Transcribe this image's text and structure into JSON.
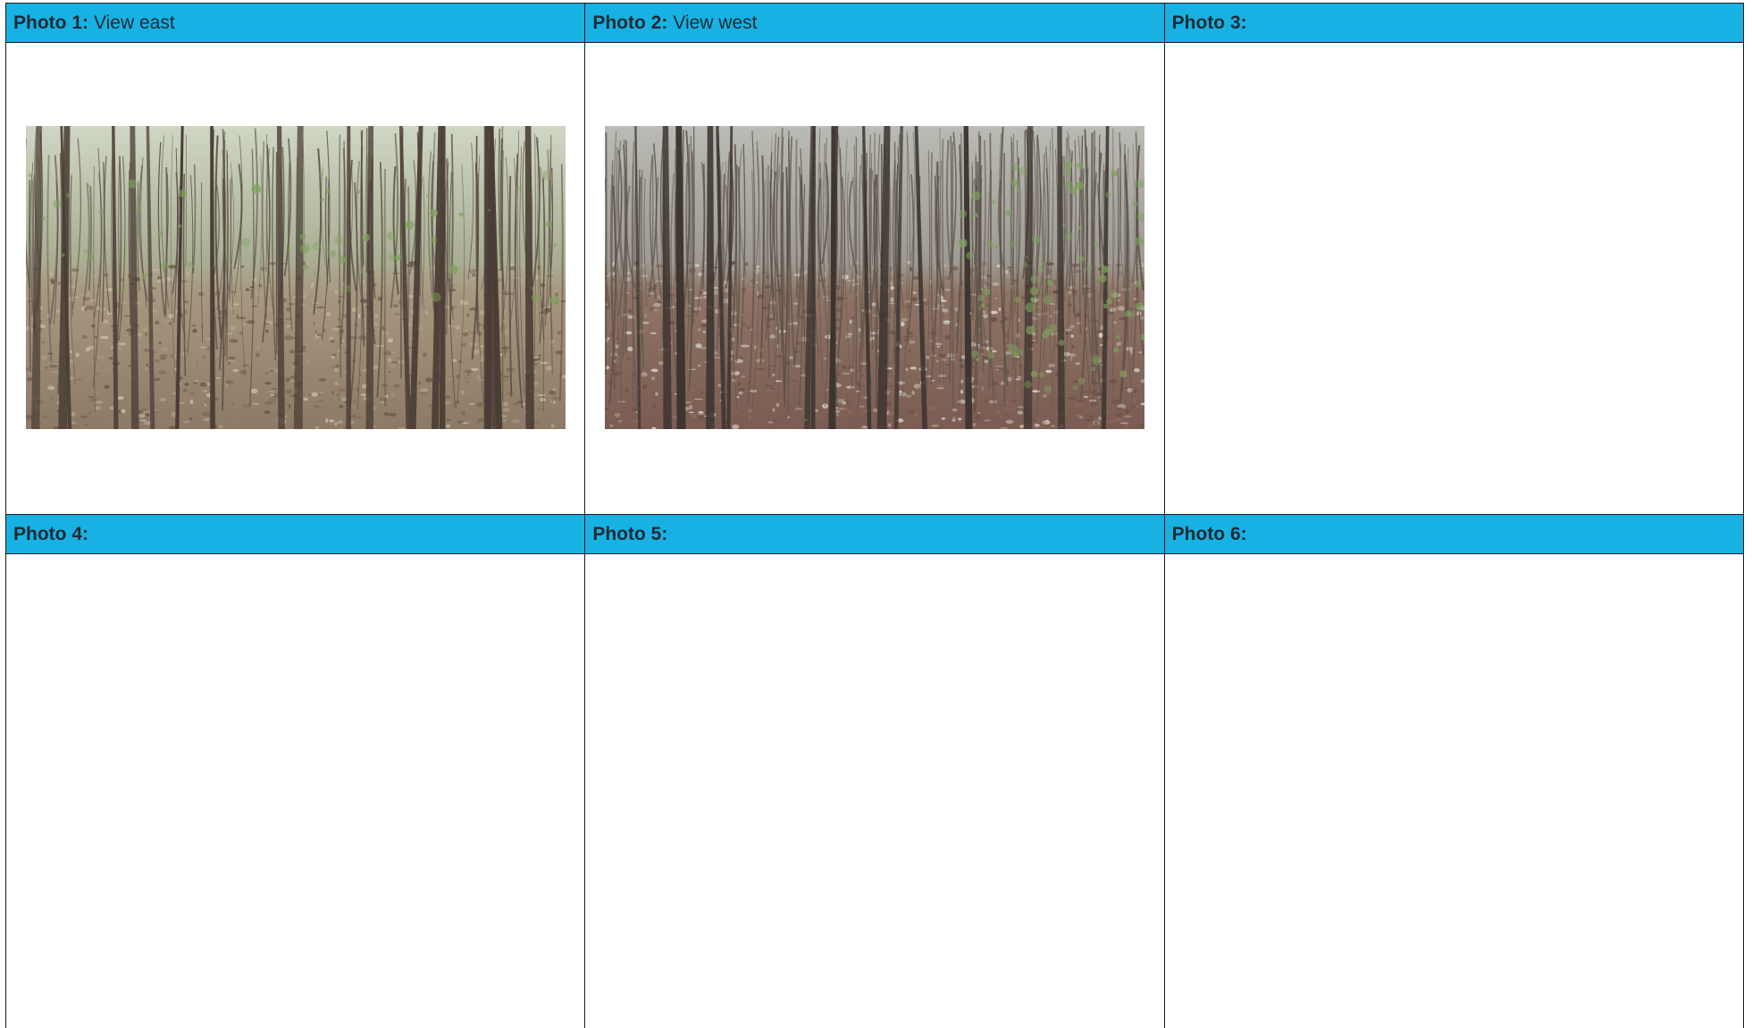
{
  "photo_log": [
    {
      "label": "Photo 1:",
      "caption": "View east",
      "has_image": true,
      "image_desc": "forest-view-east"
    },
    {
      "label": "Photo 2:",
      "caption": "View west",
      "has_image": true,
      "image_desc": "forest-view-west"
    },
    {
      "label": "Photo 3:",
      "caption": "",
      "has_image": false
    },
    {
      "label": "Photo 4:",
      "caption": "",
      "has_image": false
    },
    {
      "label": "Photo 5:",
      "caption": "",
      "has_image": false
    },
    {
      "label": "Photo 6:",
      "caption": "",
      "has_image": false
    }
  ],
  "colors": {
    "header_bg": "#17b1e3",
    "header_text": "#1f2a33",
    "border": "#1a1a1a"
  }
}
